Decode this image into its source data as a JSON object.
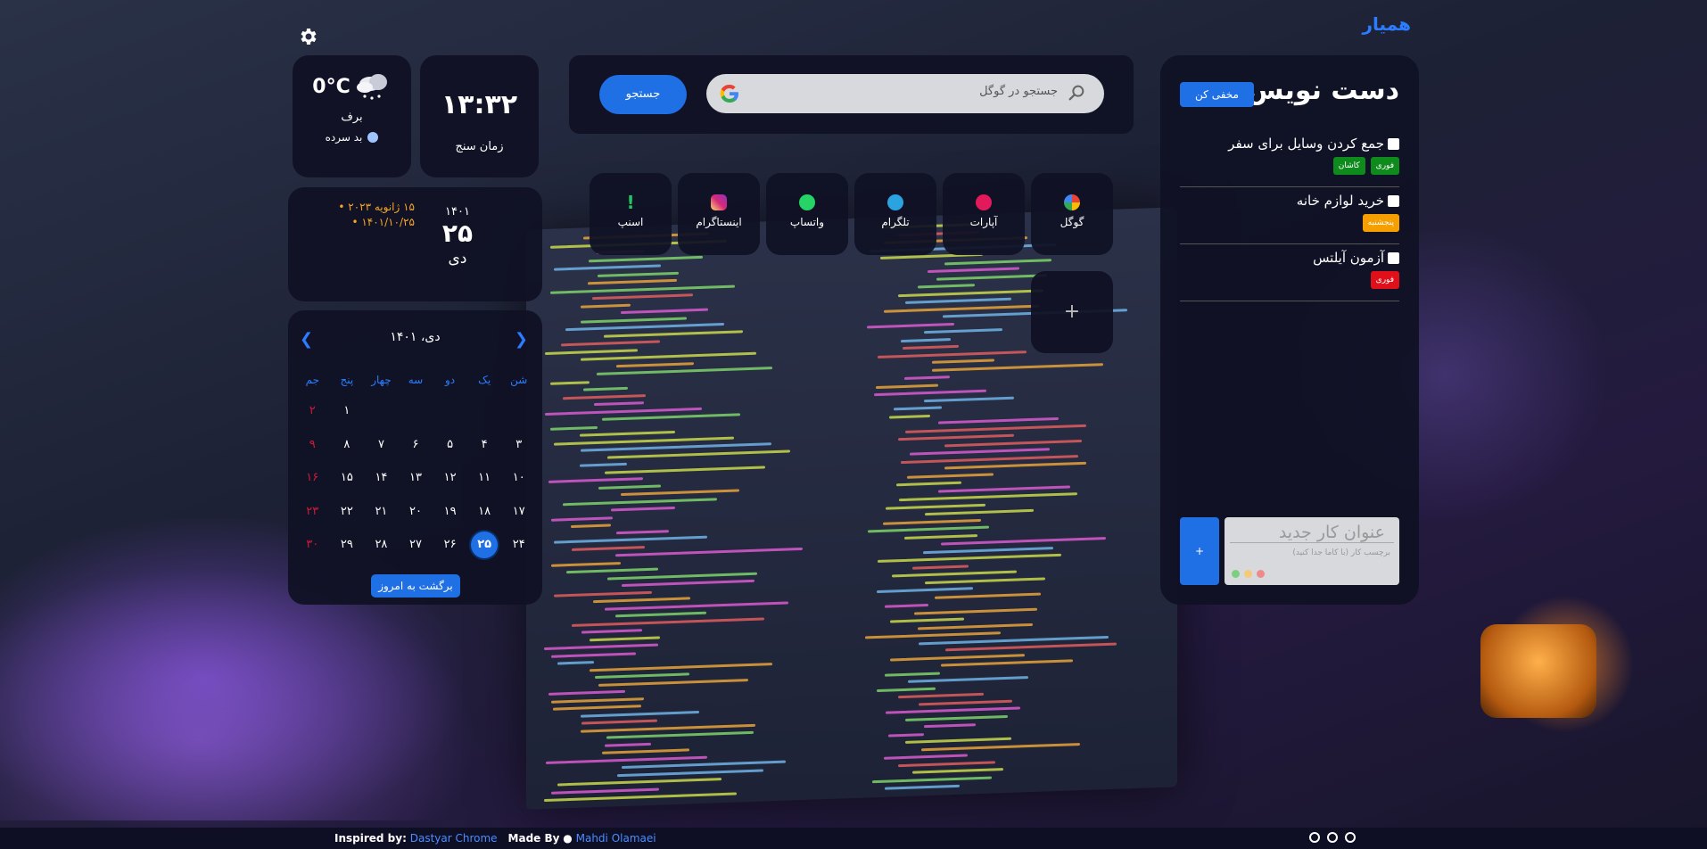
{
  "brand": "همیار",
  "clock": {
    "time": "۱۳:۳۲",
    "label": "زمان سنج"
  },
  "weather": {
    "temp": "0°C",
    "condition": "برف",
    "feel": "بد سرده"
  },
  "date": {
    "year": "۱۴۰۱",
    "day": "۲۵",
    "month": "دی",
    "alt_dates": [
      "۱۵ ژانویه ۲۰۲۳",
      "۱۴۰۱/۱۰/۲۵"
    ]
  },
  "calendar": {
    "header": "دی، ۱۴۰۱",
    "weekdays": [
      "شن",
      "یک",
      "دو",
      "سه",
      "چهار",
      "پنج",
      "جم"
    ],
    "today_button": "برگشت به امروز",
    "weeks": [
      [
        "",
        "",
        "",
        "",
        "",
        "۱",
        "۲"
      ],
      [
        "۳",
        "۴",
        "۵",
        "۶",
        "۷",
        "۸",
        "۹"
      ],
      [
        "۱۰",
        "۱۱",
        "۱۲",
        "۱۳",
        "۱۴",
        "۱۵",
        "۱۶"
      ],
      [
        "۱۷",
        "۱۸",
        "۱۹",
        "۲۰",
        "۲۱",
        "۲۲",
        "۲۳"
      ],
      [
        "۲۴",
        "۲۵",
        "۲۶",
        "۲۷",
        "۲۸",
        "۲۹",
        "۳۰"
      ]
    ],
    "today": "۲۵"
  },
  "search": {
    "placeholder": "جستجو در گوگل",
    "button": "جستجو"
  },
  "shortcuts": [
    {
      "name": "گوگل",
      "icon": "google-icon",
      "color": "#ffffff"
    },
    {
      "name": "آپارات",
      "icon": "aparat-icon",
      "color": "#e21a5b"
    },
    {
      "name": "تلگرام",
      "icon": "telegram-icon",
      "color": "#2aa3e0"
    },
    {
      "name": "واتساپ",
      "icon": "whatsapp-icon",
      "color": "#25d366"
    },
    {
      "name": "اینستاگرام",
      "icon": "instagram-icon",
      "color": "#d6249f"
    },
    {
      "name": "اسنپ",
      "icon": "snapp-icon",
      "color": "#22c55e"
    }
  ],
  "add_shortcut": "+",
  "todo": {
    "title": "دست نویس",
    "hide_button": "مخفی کن",
    "tasks": [
      {
        "title": "جمع کردن وسایل برای سفر",
        "tags": [
          {
            "text": "فوری",
            "color": "#0f8a1c"
          },
          {
            "text": "کاشان",
            "color": "#0f8a1c"
          }
        ]
      },
      {
        "title": "خرید لوازم خانه",
        "tags": [
          {
            "text": "پنجشنبه",
            "color": "#f5a000"
          }
        ]
      },
      {
        "title": "آزمون آیلتس",
        "tags": [
          {
            "text": "فوری",
            "color": "#e0101a"
          }
        ]
      }
    ],
    "new_task_placeholder": "عنوان کار جدید",
    "new_task_tags_placeholder": "برچسب کار (با کاما جدا کنید)",
    "add_button": "+"
  },
  "footer": {
    "inspired_label": "Inspired by:",
    "inspired_link": "Dastyar Chrome",
    "made_label": "Made By",
    "made_link": "Mahdi Olamaei"
  }
}
